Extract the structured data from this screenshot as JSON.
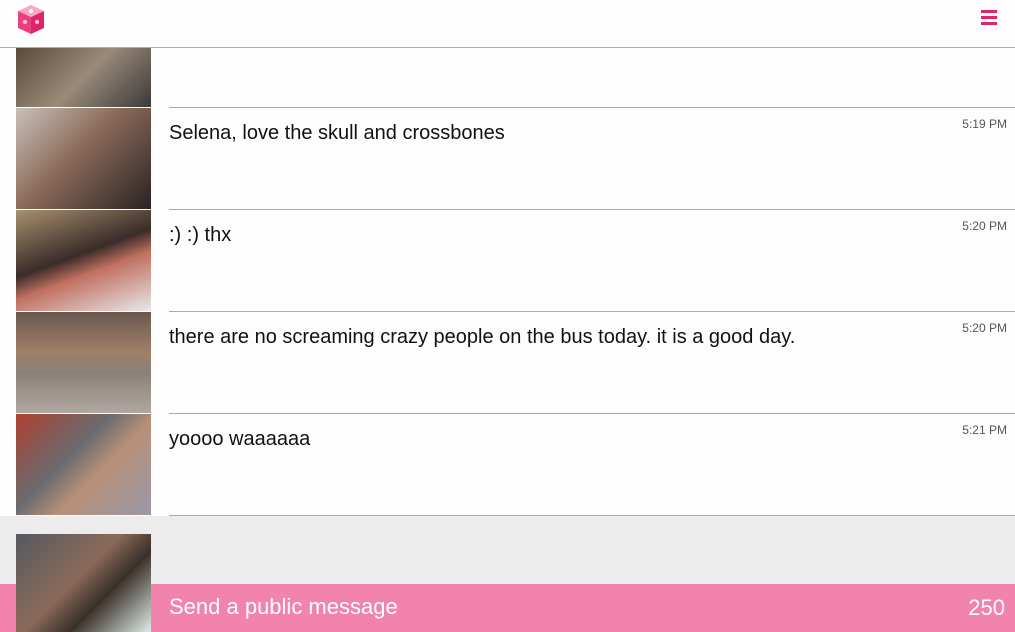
{
  "header": {
    "logo_icon": "pink-cube-logo",
    "menu_icon": "hamburger-menu-icon",
    "accent": "#e2236b"
  },
  "messages": [
    {
      "text": "Selena, love the skull and crossbones",
      "time": "5:19 PM"
    },
    {
      "text": ":) :) thx",
      "time": "5:20 PM"
    },
    {
      "text": "there are no screaming crazy people on the bus today. it is a good day.",
      "time": "5:20 PM"
    },
    {
      "text": "yoooo waaaaaa",
      "time": "5:21 PM"
    }
  ],
  "compose": {
    "placeholder": "Send a public message",
    "counter": "250",
    "bar_color": "#f283ad"
  }
}
